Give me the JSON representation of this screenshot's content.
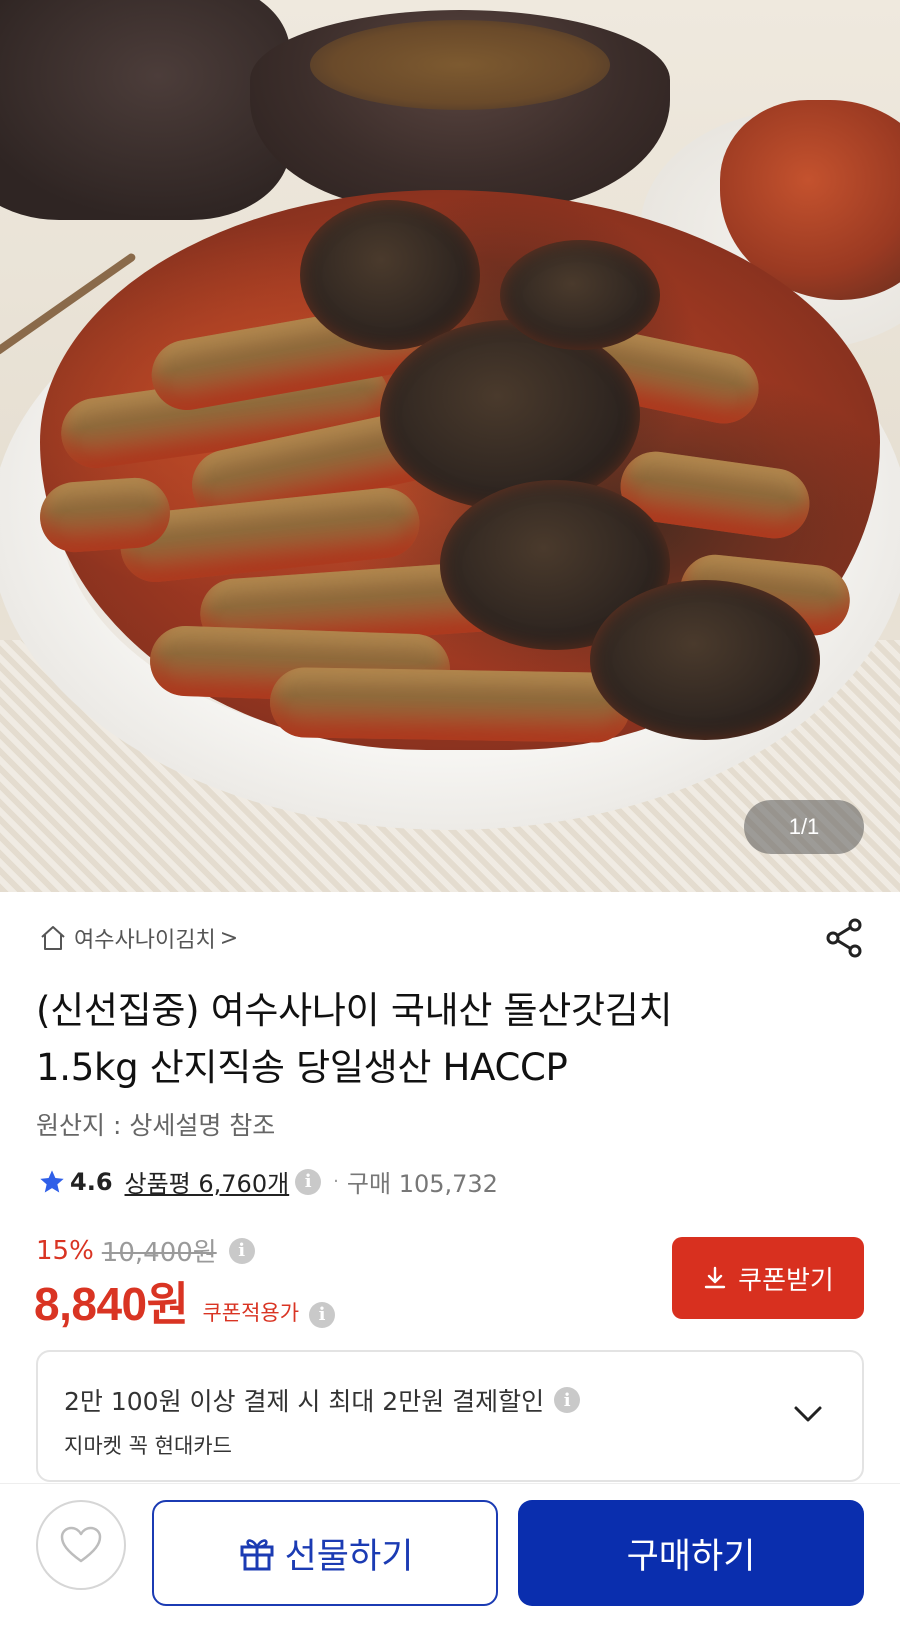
{
  "gallery": {
    "counter": "1/1"
  },
  "store": {
    "name": "여수사나이김치",
    "chevron": ">"
  },
  "product": {
    "title_line1": "(신선집중) 여수사나이 국내산 돌산갓김치",
    "title_line2": "1.5kg 산지직송 당일생산 HACCP",
    "origin": "원산지 : 상세설명 참조"
  },
  "rating": {
    "score": "4.6",
    "reviews_label": "상품평 6,760개",
    "separator": "·",
    "purchase_label": "구매 105,732",
    "star_color": "#2f5fe8"
  },
  "pricing": {
    "discount_rate": "15%",
    "original_price": "10,400원",
    "sale_price": "8,840원",
    "coupon_note": "쿠폰적용가",
    "accent_color": "#d93423"
  },
  "coupon_button": {
    "label": "쿠폰받기"
  },
  "promo": {
    "headline": "2만 100원 이상 결제 시 최대 2만원 결제할인",
    "card_name": "지마켓 꼭 현대카드"
  },
  "info_glyph": "i",
  "bottom_bar": {
    "gift_label": "선물하기",
    "buy_label": "구매하기",
    "primary_color": "#0a2eae"
  },
  "icons": {
    "home": "home-icon",
    "share": "share-icon",
    "star": "star-icon",
    "info": "info-icon",
    "download": "download-icon",
    "chevron_down": "chevron-down-icon",
    "heart": "heart-icon",
    "gift": "gift-icon"
  }
}
